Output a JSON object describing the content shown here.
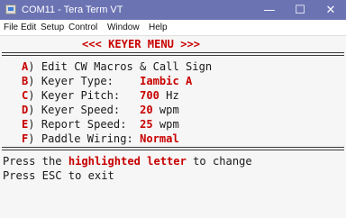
{
  "window": {
    "title": "COM11 - Tera Term VT",
    "minimize_glyph": "—",
    "maximize_glyph": "☐",
    "close_glyph": "✕"
  },
  "menu": [
    "File",
    "Edit",
    "Setup",
    "Control",
    "Window",
    "Help"
  ],
  "terminal": {
    "header": "<<< KEYER MENU >>>",
    "items": [
      {
        "key": "A",
        "label": ") Edit CW Macros & Call Sign",
        "value": "",
        "unit": ""
      },
      {
        "key": "B",
        "label": ") Keyer Type:    ",
        "value": "Iambic A",
        "unit": ""
      },
      {
        "key": "C",
        "label": ") Keyer Pitch:   ",
        "value": "700",
        "unit": " Hz"
      },
      {
        "key": "D",
        "label": ") Keyer Speed:   ",
        "value": "20",
        "unit": " wpm"
      },
      {
        "key": "E",
        "label": ") Report Speed:  ",
        "value": "25",
        "unit": " wpm"
      },
      {
        "key": "F",
        "label": ") Paddle Wiring: ",
        "value": "Normal",
        "unit": ""
      }
    ],
    "footer_prefix": "Press the ",
    "footer_highlight": "highlighted letter",
    "footer_suffix": " to change",
    "footer_line2": "Press ESC to exit"
  },
  "colors": {
    "titlebar": "#6b73b3",
    "highlight": "#c80000",
    "terminal_bg": "#f6f6f6"
  }
}
